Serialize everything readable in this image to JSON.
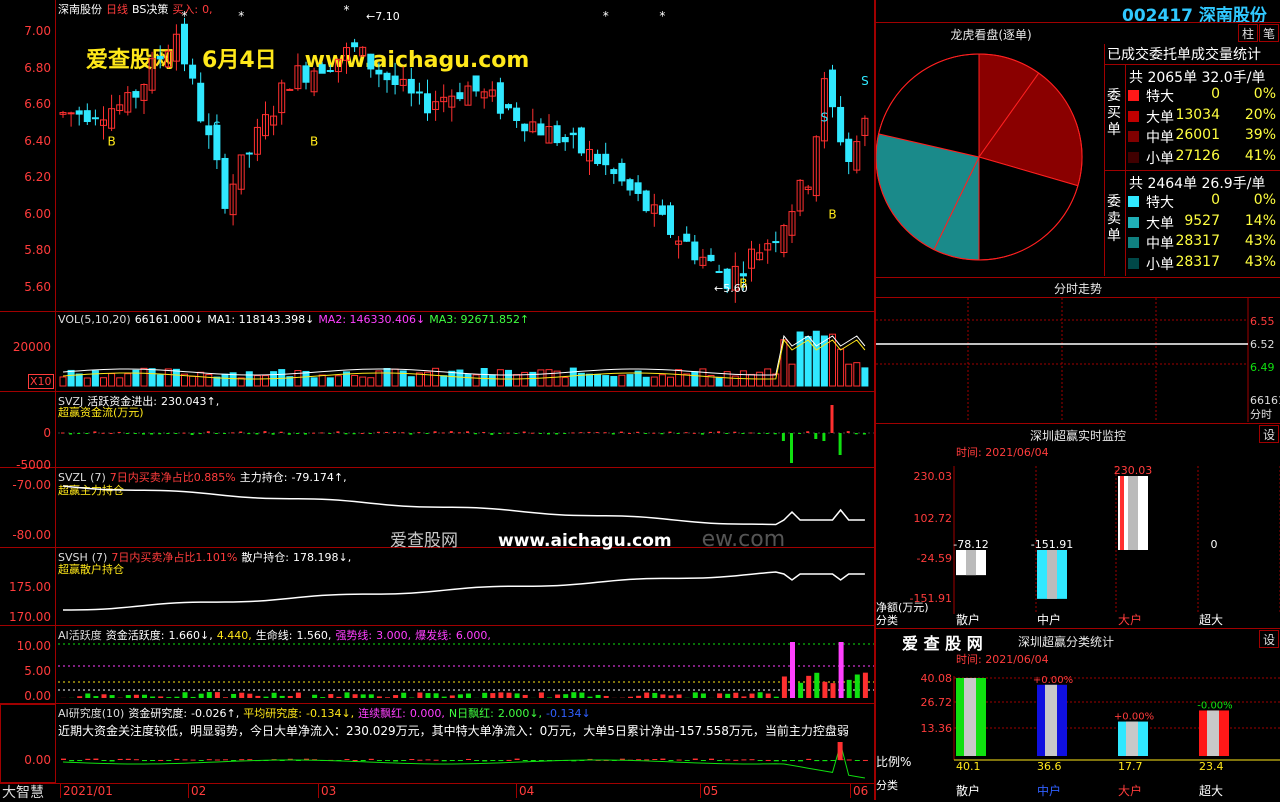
{
  "main_chart": {
    "stock_name": "深南股份",
    "period": "日线",
    "strategy": "BS决策",
    "signal_label": "买入:",
    "signal_value": "0,",
    "watermark_site": "爱查股网",
    "watermark_date": "6月4日",
    "watermark_url": "www.aichagu.com",
    "high_annotation": "7.10",
    "low_annotation": "5.60",
    "price_ticks": [
      "7.00",
      "6.80",
      "6.60",
      "6.40",
      "6.20",
      "6.00",
      "5.80",
      "5.60"
    ],
    "buy_marker": "B",
    "sell_marker": "S",
    "star_marker": "*"
  },
  "vol_panel": {
    "name": "VOL(5,10,20)",
    "value": "66161.000↓",
    "ma1": "MA1: 118143.398↓",
    "ma2": "MA2: 146330.406↓",
    "ma3": "MA3: 92671.852↑",
    "ticks": [
      "20000"
    ],
    "unit": "X10"
  },
  "svzj_panel": {
    "name": "SVZJ",
    "label": "活跃资金进出:",
    "value": "230.043↑,",
    "subtitle": "超赢资金流(万元)",
    "ticks": [
      "0",
      "-5000"
    ]
  },
  "svzl_panel": {
    "name": "SVZL",
    "param": "(7)",
    "ratio_label": "7日内买卖净占比0.885%",
    "holding_label": "主力持仓:",
    "holding_value": "-79.174↑,",
    "subtitle": "超赢主力持仓",
    "ticks": [
      "-70.00",
      "-80.00"
    ],
    "watermark_site": "爱查股网",
    "watermark_url": "www.aichagu.com",
    "watermark_faint": "ew.com"
  },
  "svsh_panel": {
    "name": "SVSH",
    "param": "(7)",
    "ratio_label": "7日内买卖净占比1.101%",
    "holding_label": "散户持仓:",
    "holding_value": "178.198↓,",
    "subtitle": "超赢散户持仓",
    "ticks": [
      "175.00",
      "170.00"
    ]
  },
  "ai_activity": {
    "name": "AI活跃度",
    "act_label": "资金活跃度:",
    "act_value": "1.660↓,",
    "act_value2": "4.440,",
    "life_label": "生命线:",
    "life_value": "1.560,",
    "strong_label": "强势线:",
    "strong_value": "3.000,",
    "burst_label": "爆发线:",
    "burst_value": "6.000,",
    "ticks": [
      "10.00",
      "5.00",
      "0.00"
    ]
  },
  "ai_research": {
    "name": "AI研究度(10)",
    "research_label": "资金研究度:",
    "research_value": "-0.026↑,",
    "avg_label": "平均研究度:",
    "avg_value": "-0.134↓,",
    "red_label": "连续飘红:",
    "red_value": "0.000,",
    "n_red_label": "N日飘红:",
    "n_red_value": "2.000↓,",
    "last_value": "-0.134↓",
    "comment": "近期大资金关注度较低，明显弱势，今日大单净流入：230.029万元，其中特大单净流入：0万元，大单5日累计净出-157.558万元，当前主力控盘弱",
    "ticks": [
      "0.00"
    ]
  },
  "date_axis": {
    "corner_label": "大智慧",
    "labels": [
      "2021/01",
      "02",
      "03",
      "04",
      "05",
      "06"
    ]
  },
  "right_header": {
    "code": "002417",
    "name": "深南股份"
  },
  "side_tabs": [
    "柱",
    "笔"
  ],
  "dragon_tiger": {
    "title": "龙虎看盘(逐单)",
    "stats_title": "已成交委托单成交量统计",
    "buy_side_label": "委买单",
    "sell_side_label": "委卖单",
    "buy_total": "共 2065单 32.0手/单",
    "sell_total": "共 2464单 26.9手/单",
    "buy_rows": [
      {
        "label": "特大",
        "count": "0",
        "pct": "0%",
        "color": "#ff1818"
      },
      {
        "label": "大单",
        "count": "13034",
        "pct": "20%",
        "color": "#c00000"
      },
      {
        "label": "中单",
        "count": "26001",
        "pct": "39%",
        "color": "#800000"
      },
      {
        "label": "小单",
        "count": "27126",
        "pct": "41%",
        "color": "#400000"
      }
    ],
    "sell_rows": [
      {
        "label": "特大",
        "count": "0",
        "pct": "0%",
        "color": "#30e8ff"
      },
      {
        "label": "大单",
        "count": "9527",
        "pct": "14%",
        "color": "#20b0b8"
      },
      {
        "label": "中单",
        "count": "28317",
        "pct": "43%",
        "color": "#108080"
      },
      {
        "label": "小单",
        "count": "28317",
        "pct": "43%",
        "color": "#004848"
      }
    ]
  },
  "intraday": {
    "title": "分时走势",
    "price_ticks": [
      "6.55",
      "6.52",
      "6.49"
    ],
    "volume_label": "66161",
    "ratio_label": "分时"
  },
  "realtime_monitor": {
    "title": "深圳超赢实时监控",
    "settings_label": "设",
    "time_label": "时间: 2021/06/04",
    "y_ticks": [
      "230.03",
      "102.72",
      "-24.59",
      "-151.91"
    ],
    "unit_label": "净额(万元)",
    "category_label": "分类",
    "categories": [
      "散户",
      "中户",
      "大户",
      "超大"
    ],
    "values": [
      -78.12,
      -151.91,
      230.03,
      0
    ],
    "value_labels": [
      "-78.12",
      "-151.91",
      "230.03",
      "0"
    ],
    "bar_colors": [
      "#ffffff",
      "#30e8ff",
      "#ffffff",
      "#ffffff"
    ]
  },
  "classify_stats": {
    "brand": "爱 查 股 网",
    "title": "深圳超赢分类统计",
    "settings_label": "设",
    "time_label": "时间: 2021/06/04",
    "y_ticks": [
      "40.08",
      "26.72",
      "13.36"
    ],
    "ratio_label": "比例%",
    "category_label": "分类",
    "categories": [
      "散户",
      "中户",
      "大户",
      "超大"
    ],
    "values": [
      40.1,
      36.6,
      17.7,
      23.4
    ],
    "value_labels": [
      "40.1",
      "36.6",
      "17.7",
      "23.4"
    ],
    "change_labels": [
      "",
      "+0.00%",
      "+0.00%",
      "-0.00%"
    ],
    "bar_colors": [
      "#10e010",
      "#1010e0",
      "#30e8ff",
      "#ff1818"
    ]
  }
}
